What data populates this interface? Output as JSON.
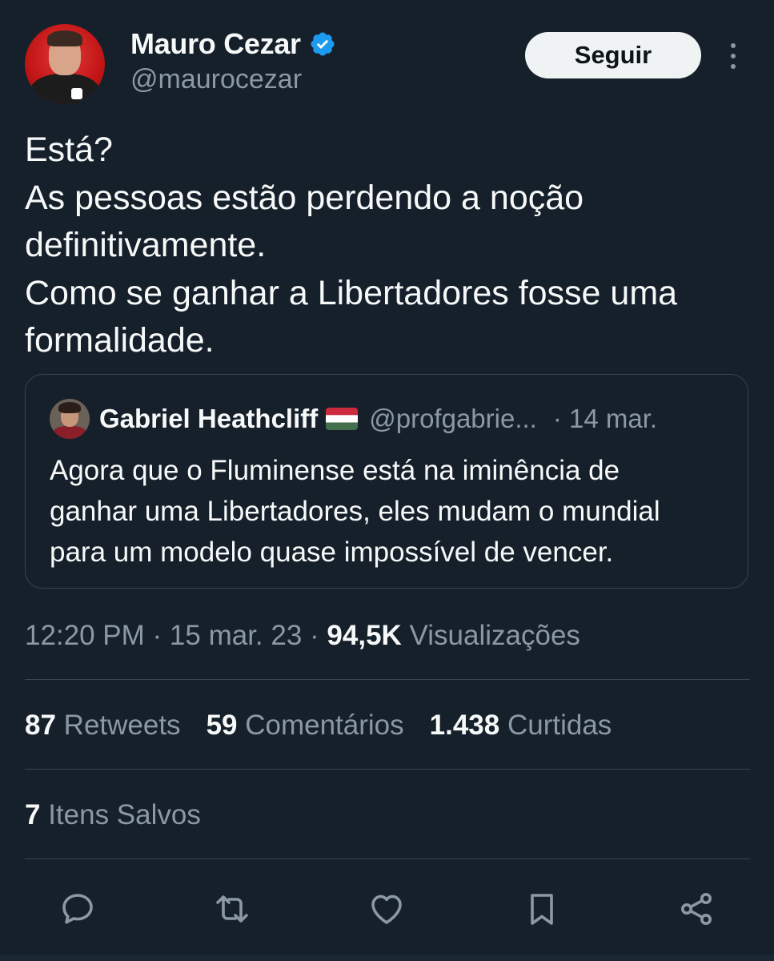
{
  "author": {
    "display_name": "Mauro Cezar",
    "handle": "@maurocezar",
    "verified": true
  },
  "follow_label": "Seguir",
  "tweet_lines": [
    "Está?",
    "As pessoas estão perdendo a noção",
    "definitivamente.",
    "Como se ganhar a Libertadores fosse uma",
    "formalidade."
  ],
  "quoted": {
    "display_name": "Gabriel Heathcliff",
    "flag_icon": "hungary-flag-icon",
    "handle": "@profgabrie...",
    "date": "· 14 mar.",
    "lines": [
      "Agora que o Fluminense está na iminência de",
      "ganhar uma Libertadores, eles mudam o mundial",
      "para um modelo quase impossível de vencer."
    ]
  },
  "meta": {
    "time": "12:20 PM",
    "sep1": " · ",
    "date": "15 mar. 23",
    "sep2": " · ",
    "views_count": "94,5K",
    "views_label": " Visualizações"
  },
  "stats": {
    "retweets_count": "87",
    "retweets_label": " Retweets",
    "comments_count": "59",
    "comments_label": " Comentários",
    "likes_count": "1.438",
    "likes_label": " Curtidas"
  },
  "saves": {
    "count": "7",
    "label": " Itens Salvos"
  },
  "colors": {
    "background": "#15202b",
    "text": "#f7f9f9",
    "secondary": "#8b98a5",
    "border": "#38444d",
    "verified": "#1d9bf0"
  },
  "action_icons": [
    "reply-icon",
    "retweet-icon",
    "like-icon",
    "bookmark-icon",
    "share-icon"
  ]
}
